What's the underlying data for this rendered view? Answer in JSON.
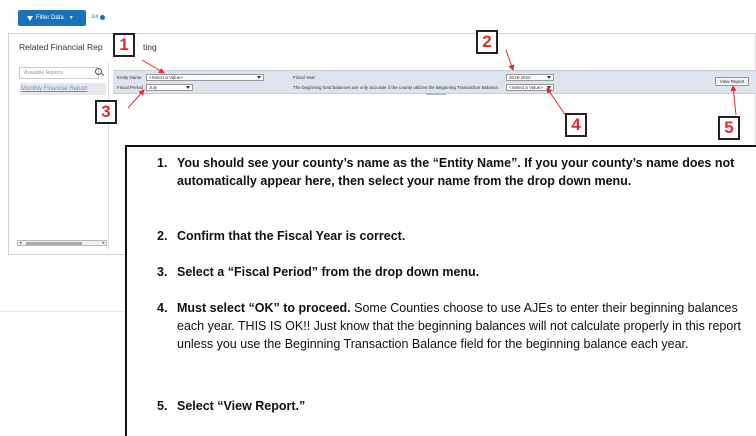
{
  "toolbar": {
    "filter_button_label": "Filter Data",
    "extra_link": "Jul"
  },
  "section": {
    "title_prefix": "Related Financial Rep",
    "title_suffix": "ting"
  },
  "sidebar": {
    "search_placeholder": "Available Reports",
    "items": [
      {
        "label": "Monthly Financial Report"
      }
    ]
  },
  "parameters": {
    "entity_name_label": "Entity Name",
    "entity_name_value": "<Select a Value>",
    "fiscal_period_label": "Fiscal Period",
    "fiscal_period_value": "July",
    "fiscal_year_label": "Fiscal Year",
    "fiscal_year_value": "2019-2020",
    "note": "The beginning fund balances are only accurate if the county utilizes the Beginning Transaction Balance.",
    "beginning_balance_value": "<Select a Value>",
    "view_report_label": "View Report"
  },
  "callouts": [
    "1",
    "2",
    "3",
    "4",
    "5"
  ],
  "callout_color": "#e8282b",
  "accent_color": "#1a73b8",
  "instructions": [
    {
      "num": "1.",
      "bold": "You should see your county’s name as the “Entity Name”.  If you your county’s name does not automatically appear here, then select your name from the drop down menu.",
      "text": ""
    },
    {
      "num": "2.",
      "bold": "Confirm that the Fiscal Year is correct.",
      "text": ""
    },
    {
      "num": "3.",
      "bold": "Select a “Fiscal Period” from the drop down menu.",
      "text": ""
    },
    {
      "num": "4.",
      "bold": "Must select “OK” to proceed.",
      "text": "  Some Counties choose to use AJEs to enter their beginning balances each year.  THIS IS OK!! Just know that the beginning balances will not calculate properly in this report unless you use the Beginning Transaction Balance field for the beginning balance each year."
    },
    {
      "num": "5.",
      "bold": "Select “View Report.”",
      "text": ""
    }
  ]
}
